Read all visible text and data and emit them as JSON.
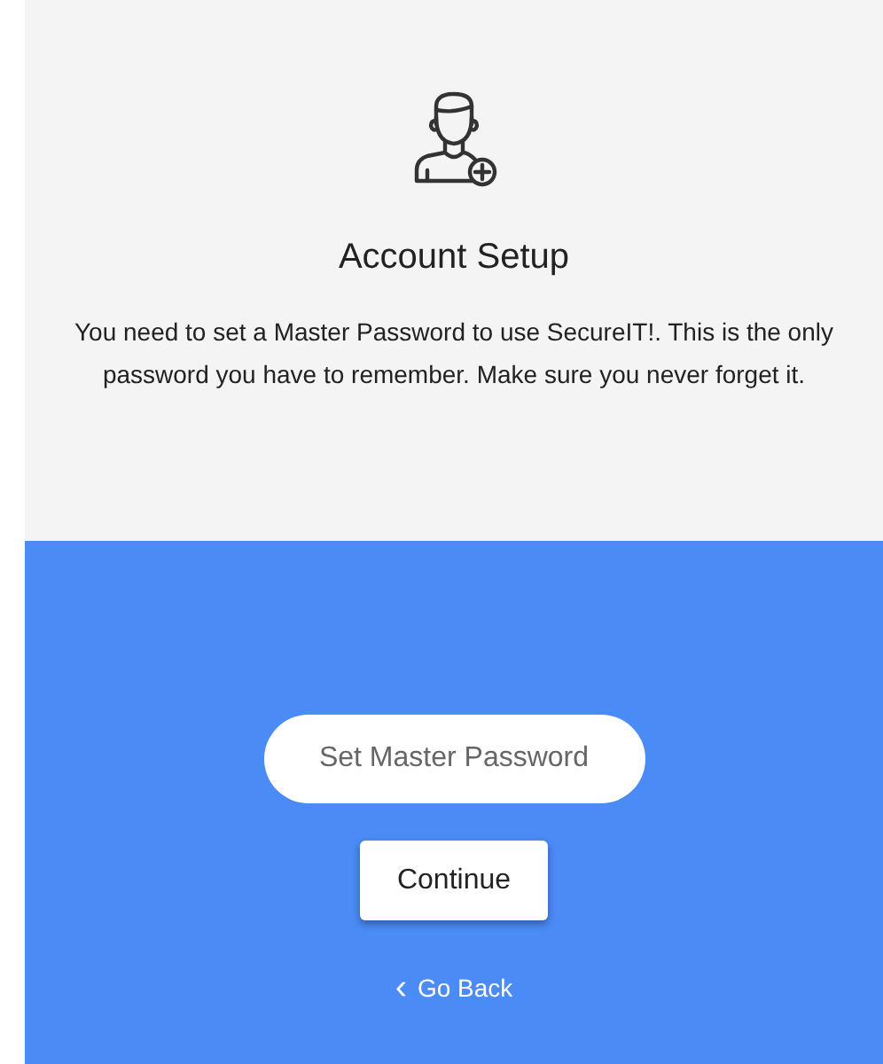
{
  "title": "Account Setup",
  "message": "You need to set a Master Password to use SecureIT!. This is the only password you have to remember. Make sure you never forget it.",
  "password_field": {
    "placeholder": "Set Master Password"
  },
  "continue_button": {
    "label": "Continue"
  },
  "back_link": {
    "icon": "‹",
    "label": "Go Back"
  }
}
